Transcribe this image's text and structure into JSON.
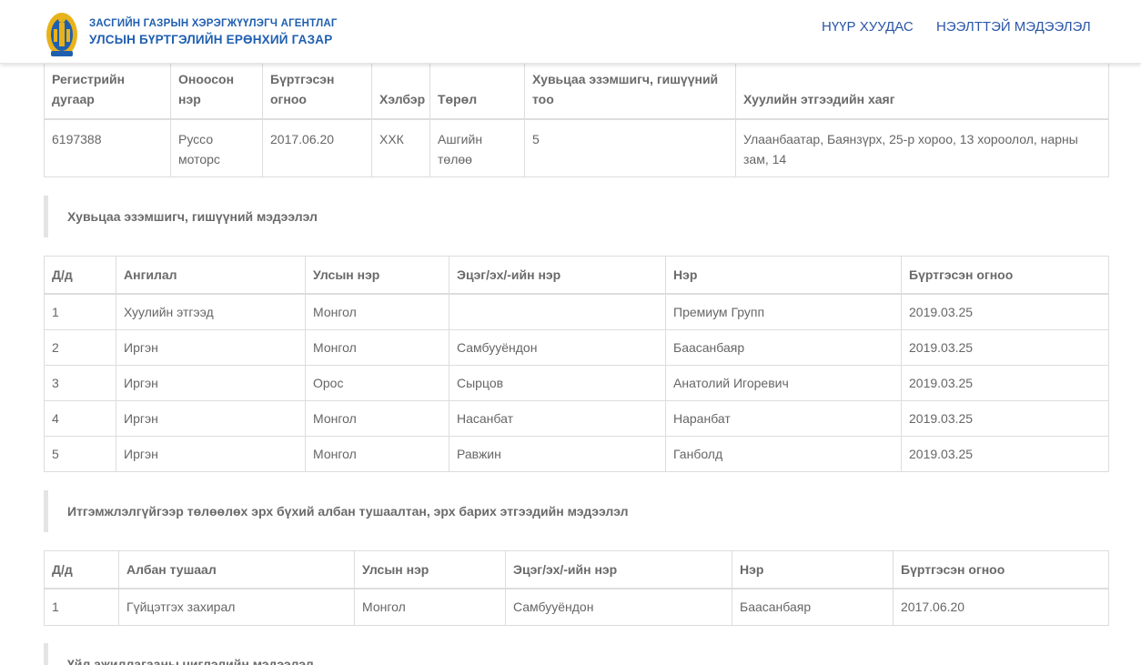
{
  "header": {
    "brand_line1": "ЗАСГИЙН ГАЗРЫН ХЭРЭГЖҮҮЛЭГЧ АГЕНТЛАГ",
    "brand_line2": "УЛСЫН БҮРТГЭЛИЙН ЕРӨНХИЙ ГАЗАР",
    "nav": {
      "home": "НҮҮР ХУУДАС",
      "public_info": "НЭЭЛТТЭЙ МЭДЭЭЛЭЛ"
    }
  },
  "entity_table": {
    "headers": [
      "Регистрийн дугаар",
      "Оноосон нэр",
      "Бүртгэсэн огноо",
      "Хэлбэр",
      "Төрөл",
      "Хувьцаа эзэмшигч, гишүүний тоо",
      "Хуулийн этгээдийн хаяг"
    ],
    "row": [
      "6197388",
      "Руссо моторс",
      "2017.06.20",
      "ХХК",
      "Ашгийн төлөө",
      "5",
      "Улаанбаатар, Баянзүрх, 25-р хороо, 13 хороолол, нарны зам, 14"
    ]
  },
  "shareholders": {
    "title": "Хувьцаа эзэмшигч, гишүүний мэдээлэл",
    "headers": [
      "Д/д",
      "Ангилал",
      "Улсын нэр",
      "Эцэг/эх/-ийн нэр",
      "Нэр",
      "Бүртгэсэн огноо"
    ],
    "rows": [
      [
        "1",
        "Хуулийн этгээд",
        "Монгол",
        "",
        "Премиум Групп",
        "2019.03.25"
      ],
      [
        "2",
        "Иргэн",
        "Монгол",
        "Самбууёндон",
        "Баасанбаяр",
        "2019.03.25"
      ],
      [
        "3",
        "Иргэн",
        "Орос",
        "Сырцов",
        "Анатолий Игоревич",
        "2019.03.25"
      ],
      [
        "4",
        "Иргэн",
        "Монгол",
        "Насанбат",
        "Наранбат",
        "2019.03.25"
      ],
      [
        "5",
        "Иргэн",
        "Монгол",
        "Равжин",
        "Ганболд",
        "2019.03.25"
      ]
    ]
  },
  "representatives": {
    "title": "Итгэмжлэлгүйгээр төлөөлөх эрх бүхий албан тушаалтан, эрх барих этгээдийн мэдээлэл",
    "headers": [
      "Д/д",
      "Албан тушаал",
      "Улсын нэр",
      "Эцэг/эх/-ийн нэр",
      "Нэр",
      "Бүртгэсэн огноо"
    ],
    "rows": [
      [
        "1",
        "Гүйцэтгэх захирал",
        "Монгол",
        "Самбууёндон",
        "Баасанбаяр",
        "2017.06.20"
      ]
    ]
  },
  "activities": {
    "title": "Үйл ажиллагааны чиглэлийн мэдээлэл"
  },
  "colors": {
    "brand_blue": "#1f5fb0",
    "nav_blue": "#2a56a8",
    "logo_gold": "#e8b21a"
  }
}
